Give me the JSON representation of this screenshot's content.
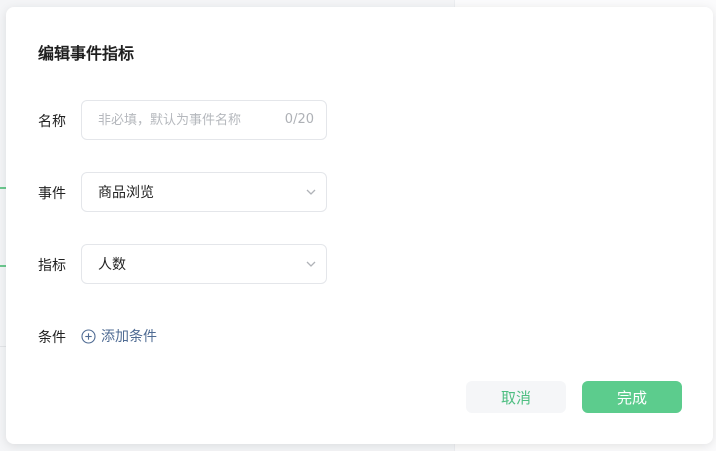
{
  "dialog": {
    "title": "编辑事件指标",
    "name_field": {
      "label": "名称",
      "value": "",
      "placeholder": "非必填，默认为事件名称",
      "counter": "0/20"
    },
    "event_field": {
      "label": "事件",
      "selected": "商品浏览"
    },
    "metric_field": {
      "label": "指标",
      "selected": "人数"
    },
    "condition": {
      "label": "条件",
      "add_label": "添加条件",
      "icon": "plus-circle-icon"
    },
    "buttons": {
      "cancel": "取消",
      "confirm": "完成"
    }
  },
  "colors": {
    "accent": "#5ccc8d",
    "accent_text": "#4dbe81",
    "link": "#4f6b93"
  }
}
